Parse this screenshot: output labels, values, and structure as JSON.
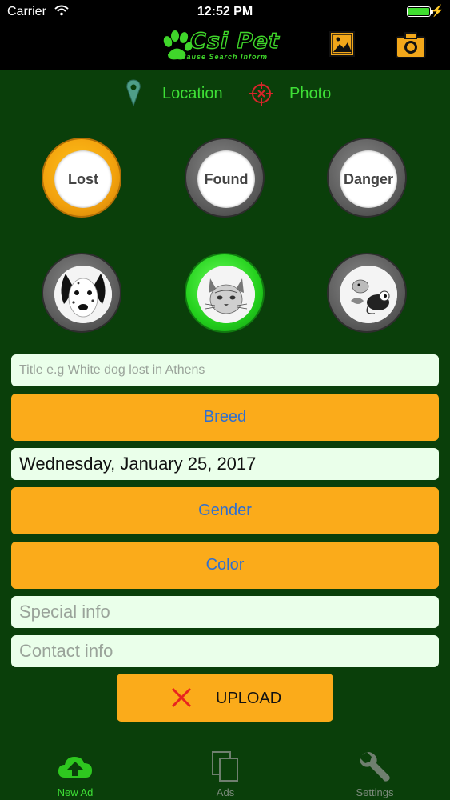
{
  "status_bar": {
    "carrier": "Carrier",
    "time": "12:52 PM"
  },
  "nav": {
    "logo_title": "Csi Pet",
    "logo_subtitle": "Cause Search Inform",
    "gallery_icon": "gallery-icon",
    "camera_icon": "camera-icon"
  },
  "location_row": {
    "location_label": "Location",
    "photo_label": "Photo"
  },
  "ad_types": [
    {
      "label": "Lost",
      "selected": true
    },
    {
      "label": "Found",
      "selected": false
    },
    {
      "label": "Danger",
      "selected": false
    }
  ],
  "animals": [
    {
      "name": "dog",
      "selected": false
    },
    {
      "name": "cat",
      "selected": true
    },
    {
      "name": "other",
      "selected": false
    }
  ],
  "form": {
    "title_placeholder": "Title e.g White dog lost in Athens",
    "breed_label": "Breed",
    "date_value": "Wednesday, January 25, 2017",
    "gender_label": "Gender",
    "color_label": "Color",
    "special_info_placeholder": "Special info",
    "contact_info_placeholder": "Contact info",
    "upload_label": "UPLOAD"
  },
  "tabs": [
    {
      "label": "New Ad",
      "icon": "cloud-upload-icon",
      "active": true
    },
    {
      "label": "Ads",
      "icon": "copy-icon",
      "active": false
    },
    {
      "label": "Settings",
      "icon": "wrench-icon",
      "active": false
    }
  ],
  "colors": {
    "background": "#0a3f0a",
    "accent_green": "#3ee036",
    "button_orange": "#fbab1a",
    "field_bg": "#eaffea",
    "button_text_blue": "#2f6fd0"
  }
}
